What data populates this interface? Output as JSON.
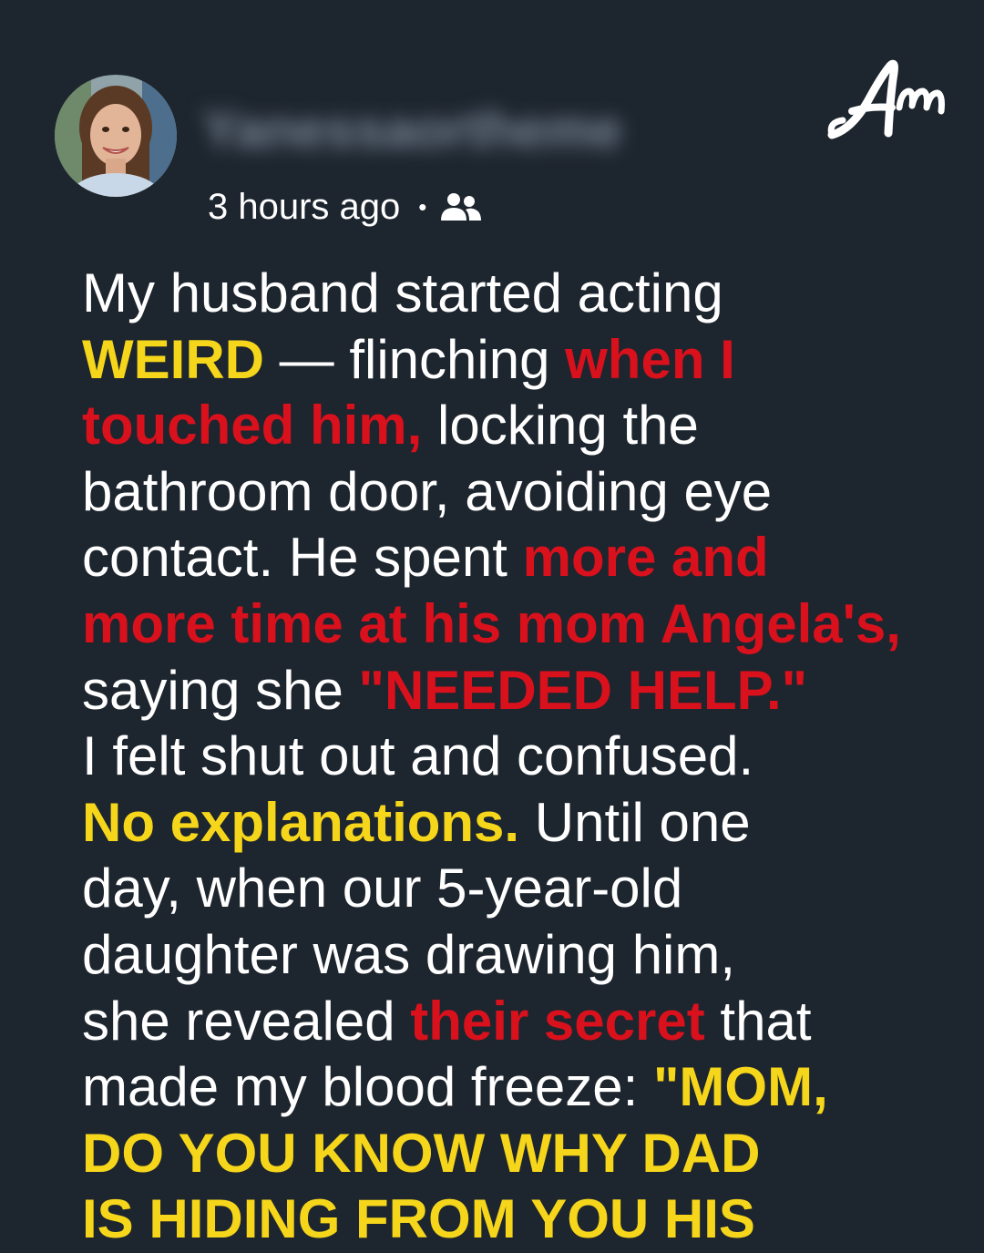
{
  "post": {
    "author_name": "Yanessaortheme",
    "time_ago": "3 hours ago",
    "separator": "•",
    "visibility_icon": "friends-icon"
  },
  "brand": {
    "logo_text": "Am",
    "logo_icon": "amomama-logo"
  },
  "colors": {
    "background": "#1d252e",
    "text": "#ffffff",
    "highlight_yellow": "#f6d61b",
    "highlight_red": "#d8111d"
  },
  "story": {
    "lines": [
      [
        {
          "text": "My husband started acting",
          "style": "plain"
        }
      ],
      [
        {
          "text": "WEIRD",
          "style": "yellow"
        },
        {
          "text": " — flinching ",
          "style": "plain"
        },
        {
          "text": "when I",
          "style": "red"
        }
      ],
      [
        {
          "text": "touched him,",
          "style": "red"
        },
        {
          "text": " locking the",
          "style": "plain"
        }
      ],
      [
        {
          "text": "bathroom door, avoiding eye",
          "style": "plain"
        }
      ],
      [
        {
          "text": "contact. He spent ",
          "style": "plain"
        },
        {
          "text": "more and",
          "style": "red"
        }
      ],
      [
        {
          "text": "more time at his mom Angela's,",
          "style": "red"
        }
      ],
      [
        {
          "text": "saying she ",
          "style": "plain"
        },
        {
          "text": "\"NEEDED HELP.\"",
          "style": "red"
        }
      ],
      [
        {
          "text": "I felt shut out and confused.",
          "style": "plain"
        }
      ],
      [
        {
          "text": "No explanations.",
          "style": "yellow"
        },
        {
          "text": " Until one",
          "style": "plain"
        }
      ],
      [
        {
          "text": "day, when our 5-year-old",
          "style": "plain"
        }
      ],
      [
        {
          "text": "daughter was drawing him,",
          "style": "plain"
        }
      ],
      [
        {
          "text": "she revealed ",
          "style": "plain"
        },
        {
          "text": "their secret",
          "style": "red"
        },
        {
          "text": " that",
          "style": "plain"
        }
      ],
      [
        {
          "text": "made my blood freeze: ",
          "style": "plain"
        },
        {
          "text": "\"MOM,",
          "style": "yellow"
        }
      ],
      [
        {
          "text": "DO YOU KNOW WHY DAD",
          "style": "yellow"
        }
      ],
      [
        {
          "text": "IS HIDING FROM YOU HIS",
          "style": "yellow"
        }
      ]
    ]
  }
}
